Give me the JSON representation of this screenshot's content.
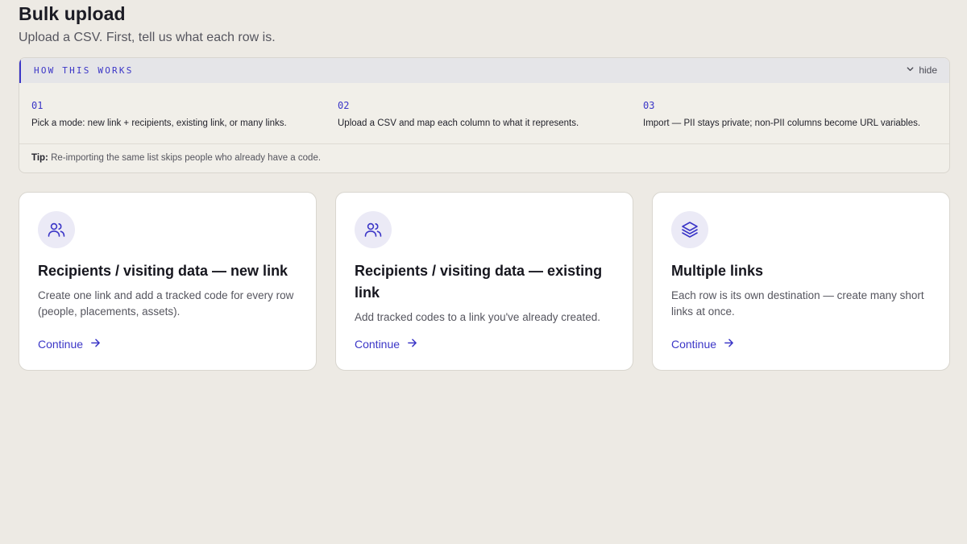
{
  "header": {
    "title": "Bulk upload",
    "subtitle": "Upload a CSV. First, tell us what each row is."
  },
  "how_it_works": {
    "label": "HOW THIS WORKS",
    "hide_label": "hide",
    "hide_icon": "chevron-down-icon",
    "steps": [
      {
        "num": "01",
        "text": "Pick a mode: new link + recipients, existing link, or many links."
      },
      {
        "num": "02",
        "text": "Upload a CSV and map each column to what it represents."
      },
      {
        "num": "03",
        "text": "Import — PII stays private; non-PII columns become URL variables."
      }
    ],
    "tip_label": "Tip:",
    "tip_text": "Re-importing the same list skips people who already have a code."
  },
  "cards": [
    {
      "icon": "users-icon",
      "title": "Recipients / visiting data — new link",
      "description": "Create one link and add a tracked code for every row (people, placements, assets).",
      "link": "Continue"
    },
    {
      "icon": "users-icon",
      "title": "Recipients / visiting data — existing link",
      "description": "Add tracked codes to a link you've already created.",
      "link": "Continue"
    },
    {
      "icon": "layers-icon",
      "title": "Multiple links",
      "description": "Each row is its own destination — create many short links at once.",
      "link": "Continue"
    }
  ],
  "colors": {
    "accent": "#3b36c7",
    "background": "#edeae4",
    "card": "#ffffff",
    "icon_bg": "#ebeaf6"
  }
}
